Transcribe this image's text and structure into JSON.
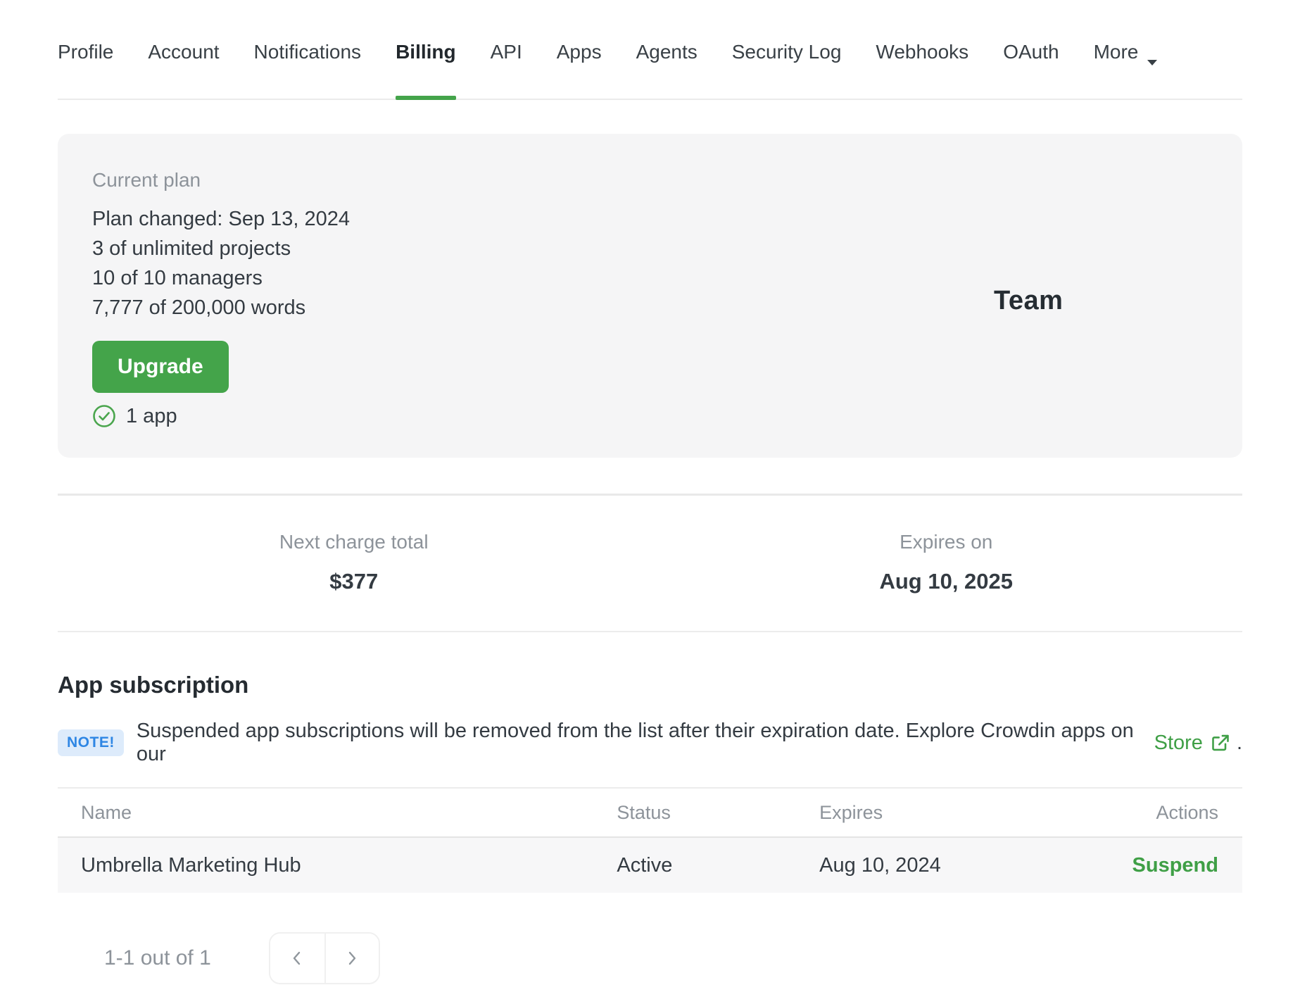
{
  "nav": {
    "tabs": [
      {
        "label": "Profile",
        "active": false
      },
      {
        "label": "Account",
        "active": false
      },
      {
        "label": "Notifications",
        "active": false
      },
      {
        "label": "Billing",
        "active": true
      },
      {
        "label": "API",
        "active": false
      },
      {
        "label": "Apps",
        "active": false
      },
      {
        "label": "Agents",
        "active": false
      },
      {
        "label": "Security Log",
        "active": false
      },
      {
        "label": "Webhooks",
        "active": false
      },
      {
        "label": "OAuth",
        "active": false
      },
      {
        "label": "More",
        "active": false
      }
    ]
  },
  "plan_card": {
    "label": "Current plan",
    "plan_changed": "Plan changed: Sep 13, 2024",
    "projects": "3 of unlimited projects",
    "managers": "10 of 10 managers",
    "words": "7,777 of 200,000 words",
    "upgrade_label": "Upgrade",
    "apps_count": "1 app",
    "plan_name": "Team"
  },
  "billing_summary": {
    "next_charge_label": "Next charge total",
    "next_charge_value": "$377",
    "expires_label": "Expires on",
    "expires_value": "Aug 10, 2025"
  },
  "app_subscription": {
    "title": "App subscription",
    "note_badge": "NOTE!",
    "note_text_before": "Suspended app subscriptions will be removed from the list after their expiration date. Explore Crowdin apps on our",
    "note_link": "Store",
    "note_text_after": ".",
    "table": {
      "headers": [
        "Name",
        "Status",
        "Expires",
        "Actions"
      ],
      "rows": [
        {
          "name": "Umbrella Marketing Hub",
          "status": "Active",
          "expires": "Aug 10, 2024",
          "action": "Suspend"
        }
      ]
    },
    "pagination": {
      "summary": "1-1 out of 1"
    }
  },
  "colors": {
    "accent_green": "#44a44a",
    "link_green": "#3f9f46",
    "note_blue": "#2e86e4",
    "note_blue_bg": "#ddebfb",
    "card_bg": "#f5f5f6",
    "row_bg": "#f7f7f8",
    "muted_text": "#8d939a",
    "dark_text": "#343b42"
  }
}
